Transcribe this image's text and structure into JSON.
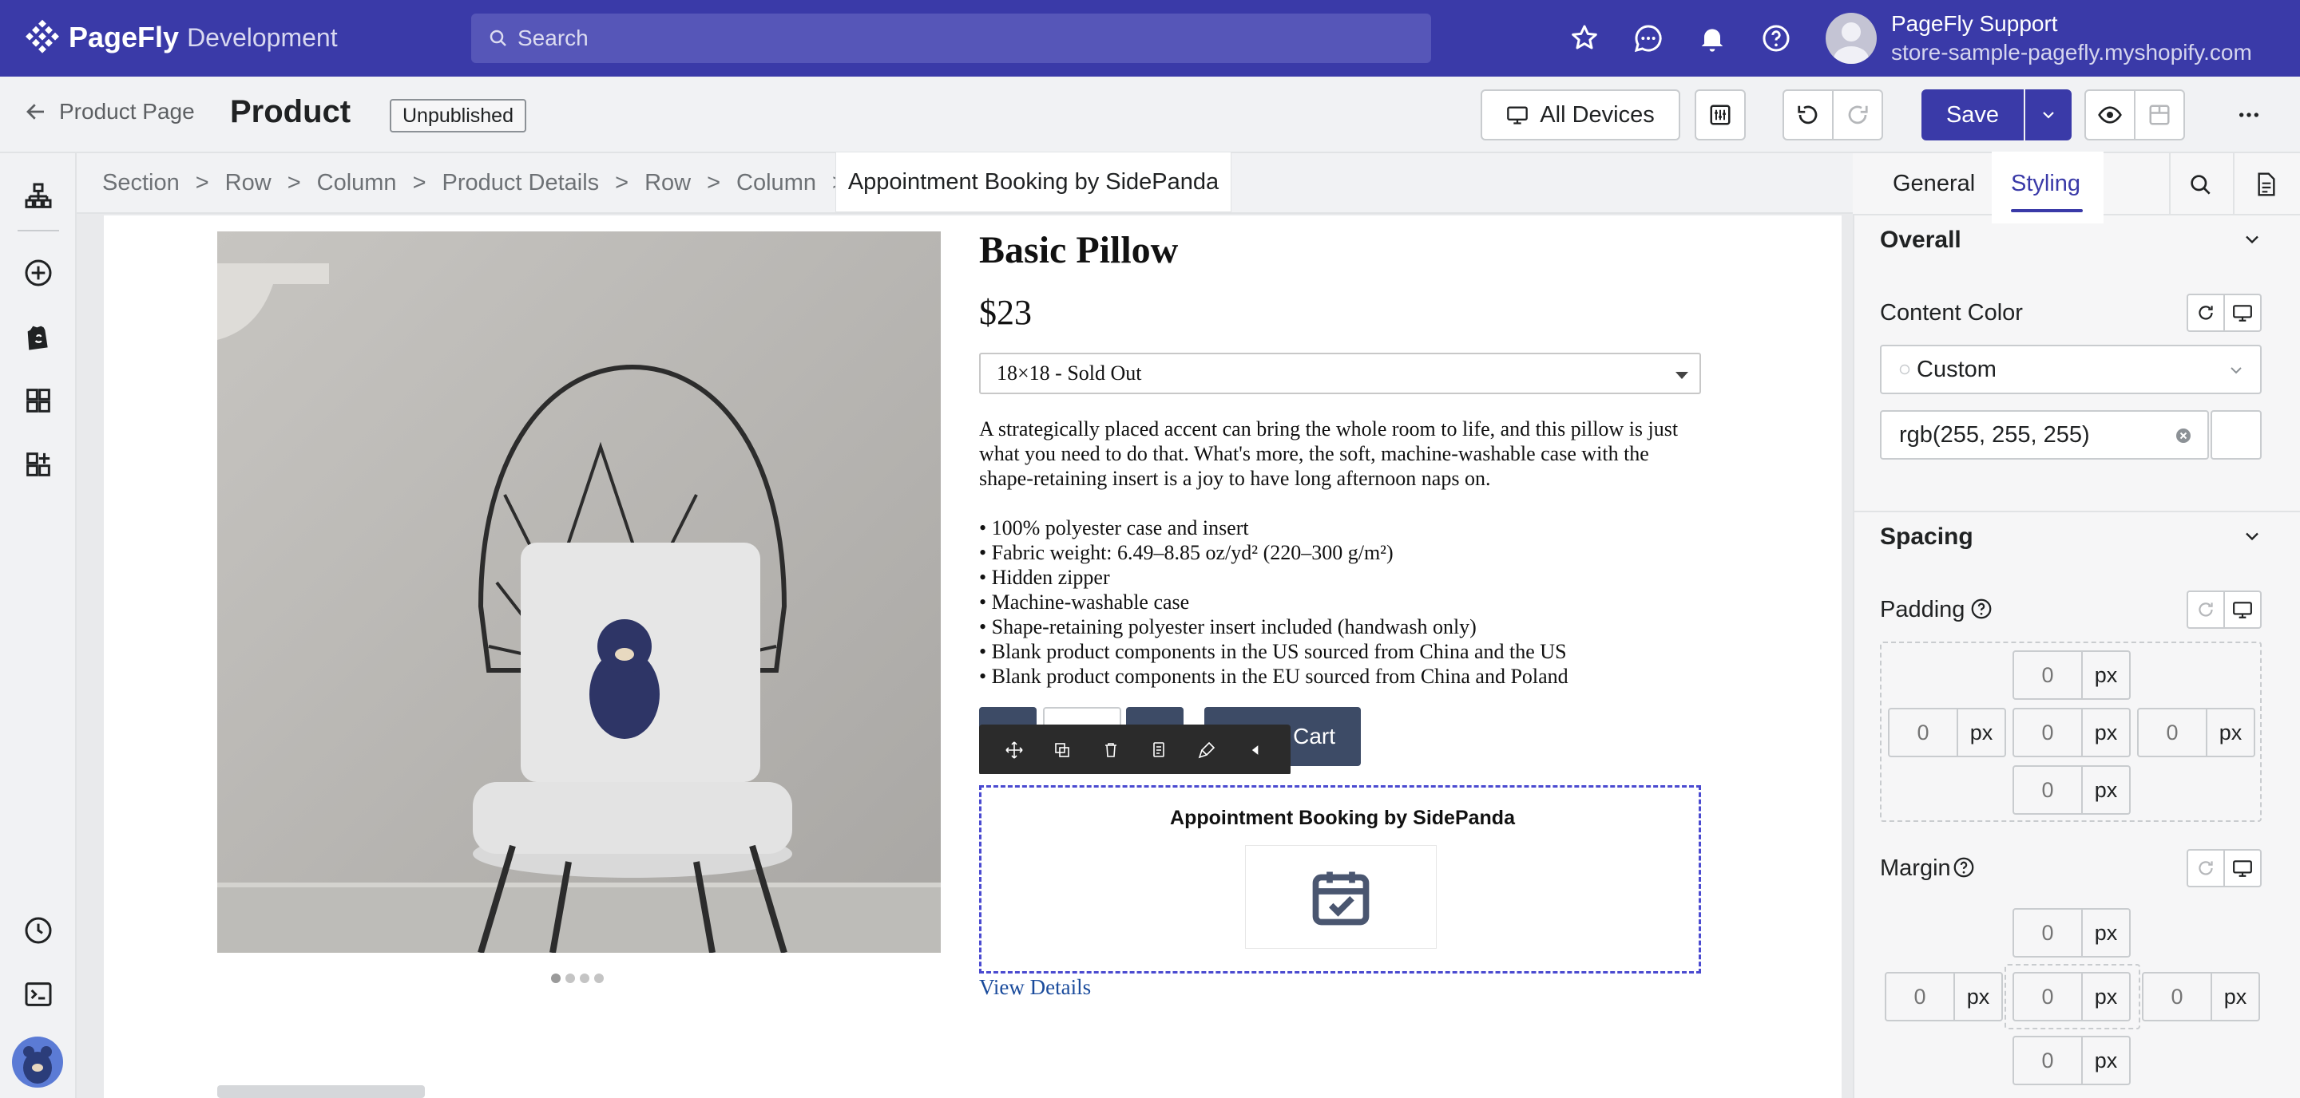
{
  "topbar": {
    "brand": "PageFly",
    "env": "Development",
    "search_placeholder": "Search",
    "user_name": "PageFly Support",
    "user_store": "store-sample-pagefly.myshopify.com"
  },
  "header": {
    "back_label": "Product Page",
    "title": "Product",
    "status": "Unpublished",
    "devices_label": "All Devices",
    "save_label": "Save"
  },
  "breadcrumb": {
    "items": [
      "Section",
      "Row",
      "Column",
      "Product Details",
      "Row",
      "Column"
    ],
    "current": "Appointment Booking by SidePanda"
  },
  "product": {
    "title": "Basic Pillow",
    "price": "$23",
    "variant": "18×18 - Sold Out",
    "description": "A strategically placed accent can bring the whole room to life, and this pillow is just what you need to do that. What's more, the soft, machine-washable case with the shape-retaining insert is a joy to have long afternoon naps on.",
    "bullets": [
      "• 100% polyester case and insert",
      "• Fabric weight: 6.49–8.85 oz/yd² (220–300 g/m²)",
      "• Hidden zipper",
      "• Machine-washable case",
      "• Shape-retaining polyester insert included (handwash only)",
      "• Blank product components in the US sourced from China and the US",
      "• Blank product components in the EU sourced from China and Poland"
    ],
    "add_to_cart_visible": "Cart",
    "app_block_title": "Appointment Booking by SidePanda",
    "view_details": "View Details"
  },
  "panel": {
    "tab_general": "General",
    "tab_styling": "Styling",
    "overall_heading": "Overall",
    "content_color_label": "Content Color",
    "color_mode": "Custom",
    "color_value": "rgb(255, 255, 255)",
    "spacing_heading": "Spacing",
    "padding_label": "Padding",
    "margin_label": "Margin",
    "zero": "0",
    "unit": "px"
  },
  "colors": {
    "topbar": "#3a3aa8",
    "accent": "#3a3aa8",
    "selection_dashed": "#4a4ad0"
  }
}
